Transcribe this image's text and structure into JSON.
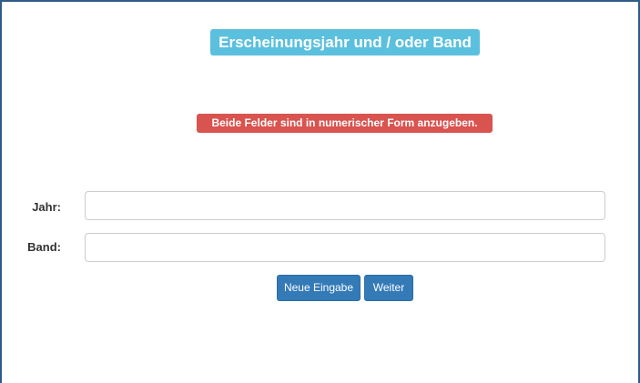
{
  "header": {
    "title": "Erscheinungsjahr und / oder Band"
  },
  "notice": {
    "text": "Beide Felder sind in numerischer Form anzugeben."
  },
  "form": {
    "jahr_label": "Jahr:",
    "jahr_value": "",
    "band_label": "Band:",
    "band_value": ""
  },
  "actions": {
    "reset_label": "Neue Eingabe",
    "next_label": "Weiter"
  },
  "colors": {
    "title_bg": "#5bc0de",
    "notice_bg": "#d9534f",
    "button_bg": "#337ab7",
    "frame_border": "#2e5c8a"
  }
}
